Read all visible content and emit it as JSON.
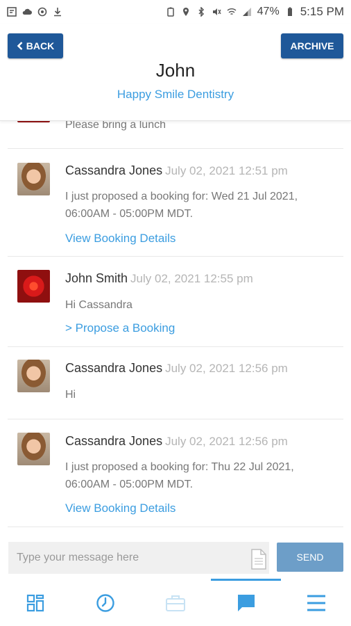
{
  "status_bar": {
    "battery_pct": "47%",
    "time": "5:15 PM"
  },
  "header": {
    "back_label": "BACK",
    "archive_label": "ARCHIVE",
    "contact_name": "John",
    "company": "Happy Smile Dentistry"
  },
  "messages": [
    {
      "body": "Please bring a lunch"
    },
    {
      "sender": "Cassandra Jones",
      "time": "July 02, 2021 12:51 pm",
      "body": "I just proposed a booking for: Wed 21 Jul 2021, 06:00AM - 05:00PM MDT.",
      "link": "View Booking Details"
    },
    {
      "sender": "John Smith",
      "time": "July 02, 2021 12:55 pm",
      "body": "Hi Cassandra",
      "link": "> Propose a Booking"
    },
    {
      "sender": "Cassandra Jones",
      "time": "July 02, 2021 12:56 pm",
      "body": "Hi"
    },
    {
      "sender": "Cassandra Jones",
      "time": "July 02, 2021 12:56 pm",
      "body": "I just proposed a booking for: Thu 22 Jul 2021, 06:00AM - 05:00PM MDT.",
      "link": "View Booking Details"
    }
  ],
  "composer": {
    "placeholder": "Type your message here",
    "send_label": "SEND"
  },
  "tabbar": {
    "active_tab": "messages",
    "icons": [
      "dashboard-icon",
      "clock-icon",
      "briefcase-icon",
      "chat-icon",
      "menu-icon"
    ]
  },
  "colors": {
    "primary": "#1f5899",
    "link": "#3b9de0",
    "send": "#6d9ec8"
  }
}
